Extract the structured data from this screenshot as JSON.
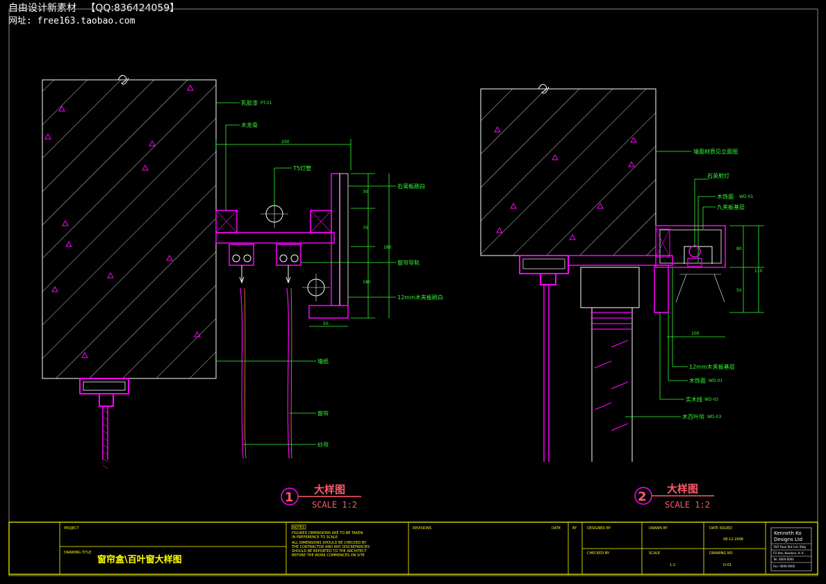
{
  "header": {
    "line1": "自由设计新素材   【QQ:836424059】",
    "line2": "网址: free163.taobao.com"
  },
  "detail1": {
    "number": "1",
    "title": "大样图",
    "scale": "SCALE 1:2",
    "labels": {
      "latex_paint": "乳胶漆",
      "latex_paint_tag": "PT-01",
      "wood_keel": "木龙骨",
      "lamp_tube": "T5灯管",
      "gypsum_board": "石膏板刷白",
      "track": "窗帘导轨",
      "wood_board": "12mm木夹板刷白",
      "wallpaper": "墙纸",
      "curtain": "窗帘",
      "sheer": "纱帘"
    },
    "dims": {
      "d200": "200",
      "d30a": "30",
      "d70": "70",
      "d280": "280",
      "d180": "180",
      "d50": "50"
    }
  },
  "detail2": {
    "number": "2",
    "title": "大样图",
    "scale": "SCALE 1:2",
    "labels": {
      "wall_ref": "墙面材质见立面图",
      "downlight": "石英射灯",
      "wood_trim": "木饰面",
      "wood_trim_tag": "WD-01",
      "nine_board": "九夹板基层",
      "board_base": "12mm木夹板基层",
      "wood_trim2": "木饰面",
      "wood_trim2_tag": "WD-01",
      "solid_wood": "实木线",
      "solid_wood_tag": "WD-02",
      "blind": "木百叶帘",
      "blind_tag": "WD-03"
    },
    "dims": {
      "d100": "100",
      "d80": "80",
      "d110": "110",
      "d50": "50"
    }
  },
  "title_block": {
    "project_label": "PROJECT",
    "drawing_title_label": "DRAWING TITLE",
    "drawing_title": "窗帘盒\\百叶窗大样图",
    "notes_tag": "NOTES",
    "notes": [
      "FIGURED DIMENSIONS ARE TO BE TAKEN",
      "IN PREFERENCE TO SCALE.",
      "ALL DIMENSIONS SHOULD BE CHECKED BY",
      "THE CONTRACTOR AND ANY DISCREPANCIES",
      "SHOULD BE REPORTED TO THE ARCHITECT",
      "BEFORE THE WORK COMMENCES ON SITE"
    ],
    "revisions_label": "REVISIONS",
    "date_label": "DATE",
    "by_label": "BY",
    "designed_by_label": "DESIGNED BY",
    "drawn_by_label": "DRAWN BY",
    "checked_by_label": "CHECKED BY",
    "scale_label": "SCALE",
    "scale_value": "1:2",
    "date_issued_label": "DATE ISSUED",
    "date_issued": "08-12-2006",
    "drawing_no_label": "DRAWING NO",
    "drawing_no": "D-01",
    "company": [
      "Kenneth Ko",
      "Designs Ltd"
    ],
    "company_lines": [
      "16/F Kwai Kok Ind. Bldg",
      "FO Kok, Kowloon, H. K.",
      "Tel: 0000-0000",
      "Fax: 0000-0000"
    ]
  },
  "colors": {
    "background": "#000000",
    "wall_outline": "#ffffff",
    "structure": "#ff00ff",
    "hatch": "#ffffff",
    "annotation": "#33ff33",
    "title_red": "#ff5a6e",
    "frame": "#ffff00"
  }
}
